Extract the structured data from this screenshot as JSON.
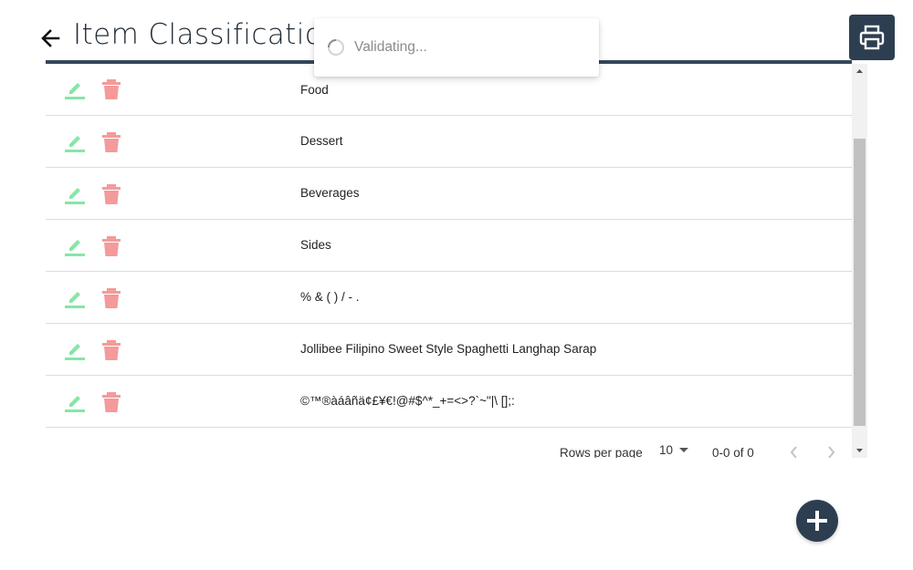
{
  "header": {
    "title": "Item Classification",
    "back_icon": "arrow-left-icon",
    "print_icon": "printer-icon",
    "accent_color": "#2d3e50"
  },
  "toast": {
    "message": "Validating...",
    "icon": "spinner-icon"
  },
  "table": {
    "edit_icon": "pencil-icon",
    "delete_icon": "trash-icon",
    "edit_color": "#86e6a6",
    "delete_color": "#f59a9a",
    "rows": [
      {
        "name": "Food"
      },
      {
        "name": "Dessert"
      },
      {
        "name": "Beverages"
      },
      {
        "name": "Sides"
      },
      {
        "name": "% & ( ) / - ."
      },
      {
        "name": "Jollibee Filipino Sweet Style Spaghetti Langhap Sarap"
      },
      {
        "name": "©™®àáâñä¢£¥€!@#$^*_+=<>?`~\"|\\ [];:"
      }
    ]
  },
  "pagination": {
    "rows_per_page_label": "Rows per page",
    "rows_per_page_value": "10",
    "range_text": "0-0 of 0"
  },
  "fab": {
    "icon": "plus-icon"
  }
}
